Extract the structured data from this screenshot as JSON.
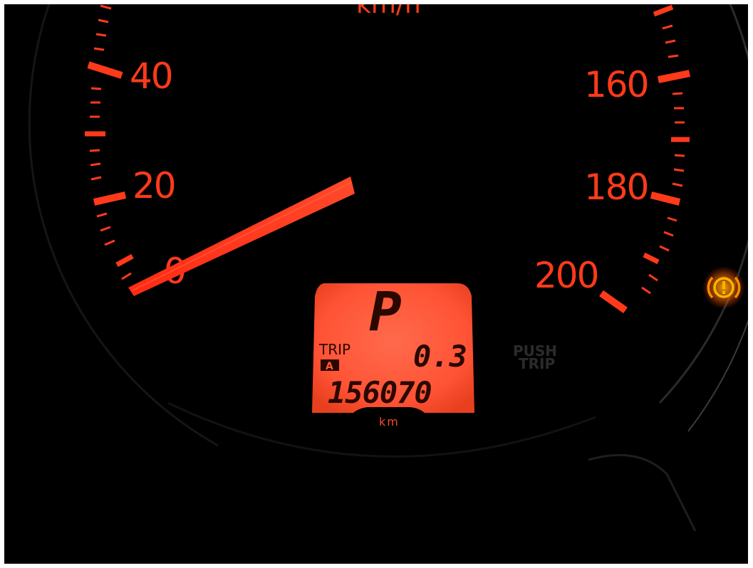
{
  "speedometer": {
    "unit": "km/h",
    "scale_labels": [
      "0",
      "20",
      "40",
      "160",
      "180",
      "200"
    ],
    "needle_reading": 0
  },
  "display": {
    "gear": "P",
    "trip_label": "TRIP",
    "trip_id": "A",
    "trip_value": "0.3",
    "odometer": "156070",
    "odometer_unit": "km"
  },
  "push_button": {
    "label_top": "PUSH",
    "label_bottom": "TRIP"
  },
  "warning_light": {
    "icon": "brake-warning-icon",
    "symbol": "(!)",
    "color": "#ff7a00"
  },
  "colors": {
    "illumination": "#ff3a1a",
    "lcd_background": "#ff5a3c",
    "background": "#000000"
  }
}
